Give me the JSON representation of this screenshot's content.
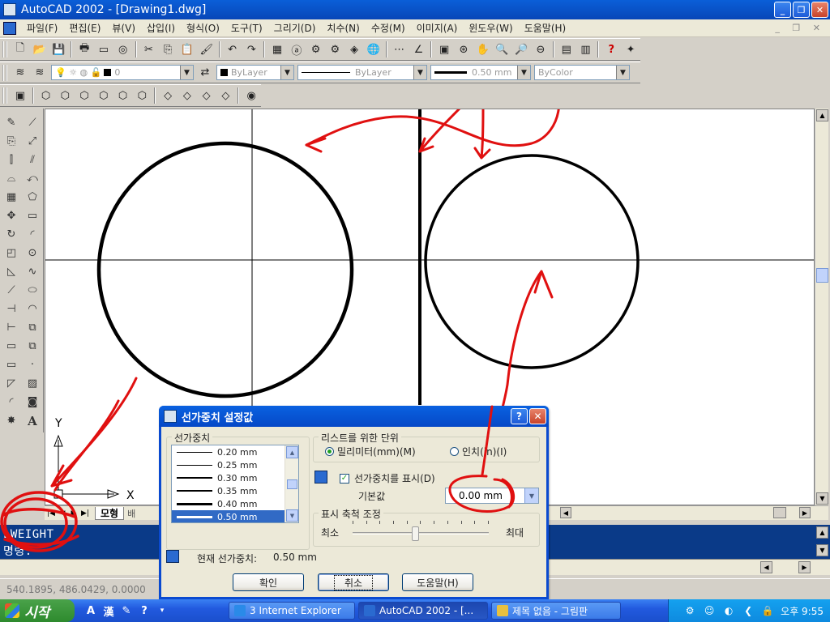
{
  "window": {
    "title": "AutoCAD 2002 - [Drawing1.dwg]",
    "buttons": {
      "minimize": "_",
      "restore": "❐",
      "close": "✕"
    }
  },
  "menu": {
    "items": [
      "파일(F)",
      "편집(E)",
      "뷰(V)",
      "삽입(I)",
      "형식(O)",
      "도구(T)",
      "그리기(D)",
      "치수(N)",
      "수정(M)",
      "이미지(A)",
      "윈도우(W)",
      "도움말(H)"
    ]
  },
  "properties_toolbar": {
    "layer_value": "0",
    "color_value": "ByLayer",
    "linetype_value": "ByLayer",
    "lineweight_value": "0.50 mm",
    "plotstyle_value": "ByColor"
  },
  "canvas": {
    "ucs_y": "Y",
    "ucs_x": "X"
  },
  "tabs": {
    "model": "모형",
    "layout": "배"
  },
  "command_window": {
    "line1": "LWEIGHT",
    "line2": "명령:"
  },
  "status": {
    "coordinates": "540.1895, 486.0429, 0.0000"
  },
  "dialog": {
    "title": "선가중치 설정값",
    "help_button": "?",
    "close_button": "✕",
    "lineweights_group": "선가중치",
    "lineweight_items": [
      {
        "label": "0.20 mm",
        "thickness": 1
      },
      {
        "label": "0.25 mm",
        "thickness": 1
      },
      {
        "label": "0.30 mm",
        "thickness": 2
      },
      {
        "label": "0.35 mm",
        "thickness": 2
      },
      {
        "label": "0.40 mm",
        "thickness": 3
      },
      {
        "label": "0.50 mm",
        "thickness": 3,
        "selected": true
      }
    ],
    "units_group": "리스트를 위한 단위",
    "unit_mm": "밀리미터(mm)(M)",
    "unit_inch": "인치(in)(I)",
    "selected_unit": "mm",
    "display_checkbox": "선가중치를 표시(D)",
    "display_checked": true,
    "default_label": "기본값",
    "default_value": "0.00 mm",
    "scale_group": "표시 축척 조정",
    "scale_min": "최소",
    "scale_max": "최대",
    "scale_position": 0.46,
    "current_label": "현재 선가중치:",
    "current_value": "0.50 mm",
    "ok_button": "확인",
    "cancel_button": "취소",
    "help_text_button": "도움말(H)"
  },
  "taskbar": {
    "start": "시작",
    "tasks": [
      {
        "label": "3 Internet Explorer",
        "color": "#2a8ae8"
      },
      {
        "label": "AutoCAD 2002 - [...",
        "color": "#2a6ad0",
        "active": true
      },
      {
        "label": "제목 없음 - 그림판",
        "color": "#e8c040"
      }
    ],
    "clock": "오후 9:55"
  }
}
